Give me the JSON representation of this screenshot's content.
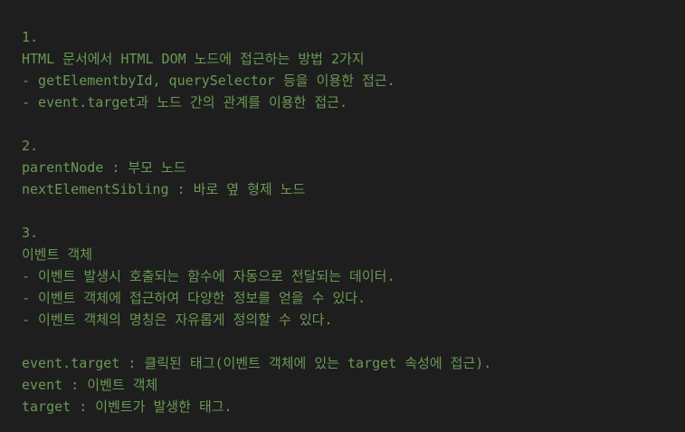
{
  "lines": [
    "1.",
    "HTML 문서에서 HTML DOM 노드에 접근하는 방법 2가지",
    "- getElementbyId, querySelector 등을 이용한 접근.",
    "- event.target과 노드 간의 관계를 이용한 접근.",
    "",
    "2.",
    "parentNode : 부모 노드",
    "nextElementSibling : 바로 옆 형제 노드",
    "",
    "3.",
    "이벤트 객체",
    "- 이벤트 발생시 호출되는 함수에 자동으로 전달되는 데이터.",
    "- 이벤트 객체에 접근하여 다양한 정보를 얻을 수 있다.",
    "- 이벤트 객체의 명칭은 자유롭게 정의할 수 있다.",
    "",
    "event.target : 클릭된 태그(이벤트 객체에 있는 target 속성에 접근).",
    "event : 이벤트 객체",
    "target : 이벤트가 발생한 태그."
  ],
  "colors": {
    "background": "#1e1e1e",
    "comment_text": "#6a9955"
  }
}
